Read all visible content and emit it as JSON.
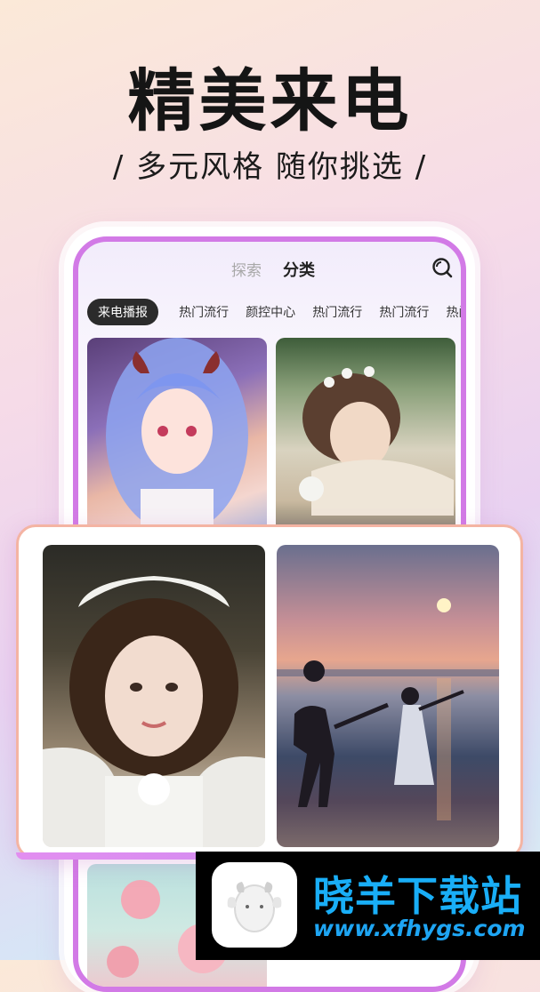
{
  "headline": "精美来电",
  "subline": "/ 多元风格  随你挑选 /",
  "tabs": {
    "explore": "探索",
    "category": "分类"
  },
  "chips": [
    "来电播报",
    "热门流行",
    "颜控中心",
    "热门流行",
    "热门流行",
    "热门"
  ],
  "images": [
    {
      "name": "anime-girl-blue-hair-photo"
    },
    {
      "name": "girl-lying-with-flower-crown-photo"
    },
    {
      "name": "girl-with-feather-headdress-photo"
    },
    {
      "name": "couple-on-beach-at-sunset-photo"
    },
    {
      "name": "pink-flowers-photo"
    }
  ],
  "watermark": {
    "title": "晓羊下载站",
    "url": "www.xfhygs.com"
  },
  "colors": {
    "accent_border": "#d27ae6",
    "front_border": "#f4b4a3",
    "watermark_text": "#19aef7"
  },
  "icons": [
    "search-icon",
    "sheep-logo-icon"
  ]
}
